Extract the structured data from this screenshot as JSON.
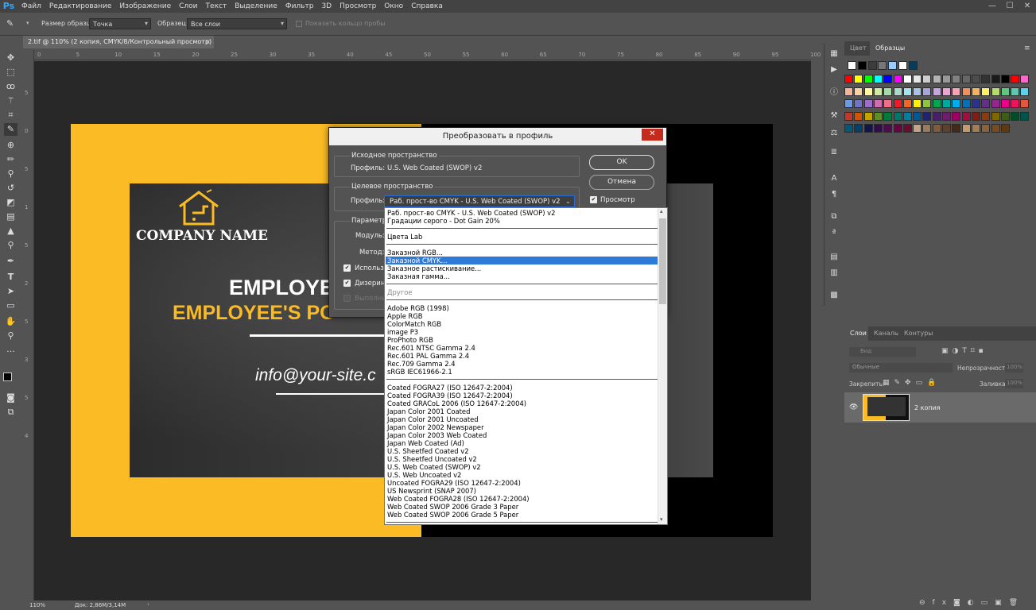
{
  "app": {
    "logo": "Ps"
  },
  "menu": [
    "Файл",
    "Редактирование",
    "Изображение",
    "Слои",
    "Текст",
    "Выделение",
    "Фильтр",
    "3D",
    "Просмотр",
    "Окно",
    "Справка"
  ],
  "window_controls": {
    "min": "—",
    "max": "☐",
    "close": "✕"
  },
  "options_bar": {
    "sample_size_label": "Размер образца:",
    "sample_size_value": "Точка",
    "sample_label": "Образец:",
    "sample_value": "Все слои",
    "show_ring": "Показать кольцо пробы"
  },
  "document_tab": {
    "title": "2.tif @ 110% (2 копия, CMYK/8/Контрольный просмотр) *",
    "close": "×"
  },
  "ruler_h": [
    "0",
    "5",
    "10",
    "15",
    "20",
    "25",
    "30",
    "35",
    "40",
    "45",
    "50",
    "55",
    "60",
    "65",
    "70",
    "75",
    "80",
    "85",
    "90",
    "95",
    "100"
  ],
  "ruler_v": [
    "5",
    "0",
    "5",
    "1",
    "5",
    "2",
    "5",
    "3",
    "5",
    "4"
  ],
  "canvas": {
    "company_name": "COMPANY NAME",
    "employee_name": "EMPLOYE",
    "employee_position": "EMPLOYEE'S PO",
    "email": "info@your-site.c"
  },
  "status": {
    "zoom": "110%",
    "doc": "Док: 2,86M/3,14M"
  },
  "swatch_panel": {
    "tab_color": "Цвет",
    "tab_swatches": "Образцы",
    "menu": "≡"
  },
  "swatch_colors": {
    "row0": [
      "#ffffff",
      "#000000",
      "#3c3c3c",
      "#777777",
      "#9bcbff",
      "#ffffff",
      "#0a3a5c"
    ],
    "rows": [
      [
        "#ff0000",
        "#ffff00",
        "#00ff00",
        "#00ffff",
        "#0000ff",
        "#ff00ff",
        "#ffffff",
        "#e6e6e6",
        "#cccccc",
        "#b3b3b3",
        "#999999",
        "#808080",
        "#666666",
        "#4d4d4d",
        "#333333",
        "#1a1a1a",
        "#000000",
        "#ff0000",
        "#ff66cc"
      ],
      [
        "#f5b59b",
        "#f8d2a6",
        "#fff6a6",
        "#d2e8a6",
        "#a6dca6",
        "#a6dcc9",
        "#a6e3f0",
        "#a6c4e8",
        "#a6a6dc",
        "#c4a6dc",
        "#e8a6d2",
        "#f5a6b4",
        "#f58f5a",
        "#f7b35b",
        "#fff166",
        "#b8d96d",
        "#5fc580",
        "#5fc7b0",
        "#5fd0ea"
      ],
      [
        "#6c9be6",
        "#7173c9",
        "#9b6fc9",
        "#d16cb0",
        "#ee6f86",
        "#ee1c25",
        "#f46524",
        "#fff100",
        "#8cc63f",
        "#00a650",
        "#00a99d",
        "#00aeef",
        "#0072bc",
        "#2e3192",
        "#662d91",
        "#92278f",
        "#ec008c",
        "#ed145b",
        "#e2583e"
      ],
      [
        "#c0392b",
        "#d35400",
        "#c6a300",
        "#5f8d27",
        "#007a3d",
        "#00756b",
        "#007da7",
        "#005696",
        "#1f2273",
        "#4b1e6c",
        "#6c1d6b",
        "#9d0062",
        "#9e1040",
        "#7f1f14",
        "#8b3b0e",
        "#806800",
        "#3e5c1a",
        "#004d27",
        "#00554b"
      ],
      [
        "#00597a",
        "#00406e",
        "#131547",
        "#310e4a",
        "#4d0d4b",
        "#6b0043",
        "#6a0c2b",
        "#c4a584",
        "#9b7b5b",
        "#7c5d3f",
        "#5e4129",
        "#432a17",
        "#c69c6d",
        "#a67c52",
        "#8c6239",
        "#754c24",
        "#603913"
      ]
    ]
  },
  "layers_panel": {
    "tabs": [
      "Слои",
      "Каналы",
      "Контуры"
    ],
    "kind_label": "Вид",
    "blend_mode": "Обычные",
    "opacity_label": "Непрозрачность:",
    "opacity_value": "100%",
    "lock_label": "Закрепить:",
    "fill_label": "Заливка:",
    "fill_value": "100%",
    "layer_name": "2 копия"
  },
  "dialog": {
    "title": "Преобразовать в профиль",
    "close": "✕",
    "source_group": "Исходное пространство",
    "source_profile_label": "Профиль:",
    "source_profile_value": "U.S. Web Coated (SWOP) v2",
    "dest_group": "Целевое пространство",
    "dest_profile_label": "Профиль:",
    "dest_profile_value": "Раб. прост-во CMYK - U.S. Web Coated (SWOP) v2",
    "params_group": "Параметры",
    "module_label": "Модуль:",
    "method_label": "Метод:",
    "use_label": "Использ",
    "dither_label": "Дизерин",
    "flatten_label": "Выполни",
    "ok": "OK",
    "cancel": "Отмена",
    "preview": "Просмотр"
  },
  "dropdown": {
    "g1": [
      "Раб. прост-во CMYK - U.S. Web Coated (SWOP) v2",
      "Градации серого - Dot Gain 20%"
    ],
    "g2": [
      "Цвета Lab"
    ],
    "g3": [
      "Заказной RGB...",
      "Заказной CMYK...",
      "Заказное растискивание...",
      "Заказная гамма..."
    ],
    "g4": [
      "Другое"
    ],
    "g5": [
      "Adobe RGB (1998)",
      "Apple RGB",
      "ColorMatch RGB",
      "image P3",
      "ProPhoto RGB",
      "Rec.601 NTSC Gamma 2.4",
      "Rec.601 PAL Gamma 2.4",
      "Rec.709 Gamma 2.4",
      "sRGB IEC61966-2.1"
    ],
    "g6": [
      "Coated FOGRA27 (ISO 12647-2:2004)",
      "Coated FOGRA39 (ISO 12647-2:2004)",
      "Coated GRACoL 2006 (ISO 12647-2:2004)",
      "Japan Color 2001 Coated",
      "Japan Color 2001 Uncoated",
      "Japan Color 2002 Newspaper",
      "Japan Color 2003 Web Coated",
      "Japan Web Coated (Ad)",
      "U.S. Sheetfed Coated v2",
      "U.S. Sheetfed Uncoated v2",
      "U.S. Web Coated (SWOP) v2",
      "U.S. Web Uncoated v2",
      "Uncoated FOGRA29 (ISO 12647-2:2004)",
      "US Newsprint (SNAP 2007)",
      "Web Coated FOGRA28 (ISO 12647-2:2004)",
      "Web Coated SWOP 2006 Grade 3 Paper",
      "Web Coated SWOP 2006 Grade 5 Paper"
    ]
  }
}
